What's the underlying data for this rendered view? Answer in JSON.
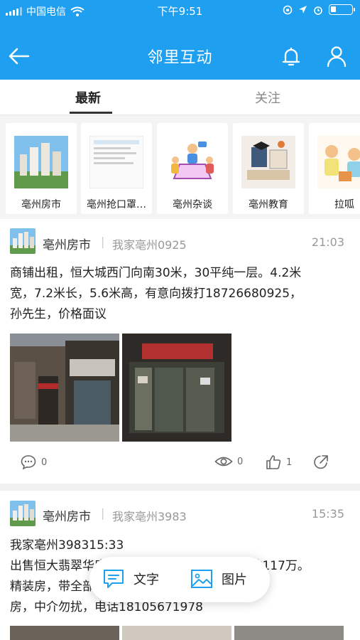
{
  "status_bar": {
    "carrier": "中国电信",
    "time": "下午9:51"
  },
  "header": {
    "title": "邻里互动"
  },
  "tabs": [
    {
      "label": "最新"
    },
    {
      "label": "关注"
    }
  ],
  "categories": [
    {
      "label": "亳州房市"
    },
    {
      "label": "亳州抢口罩…"
    },
    {
      "label": "亳州杂谈"
    },
    {
      "label": "亳州教育"
    },
    {
      "label": "拉呱"
    }
  ],
  "posts": [
    {
      "board": "亳州房市",
      "author": "我家亳州0925",
      "time": "21:03",
      "lines": [
        "商铺出租，恒大城西门向南30米，30平纯一层。4.2米",
        "宽，7.2米长，5.6米高，有意向拨打18726680925，",
        "孙先生，价格面议"
      ],
      "comments": "0",
      "views": "0",
      "likes": "1"
    },
    {
      "board": "亳州房市",
      "author": "我家亳州3983",
      "time": "15:35",
      "lines": [
        "我家亳州398315:33",
        "出售恒大翡翠华庭，三室两厅，122平米，全款117万。",
        "精装房，带全部家具家电，拎包入住。自己的",
        "房，中介勿扰，电话18105671978"
      ]
    }
  ],
  "compose": {
    "text_label": "文字",
    "image_label": "图片"
  },
  "colors": {
    "brand": "#1e9ff0"
  }
}
